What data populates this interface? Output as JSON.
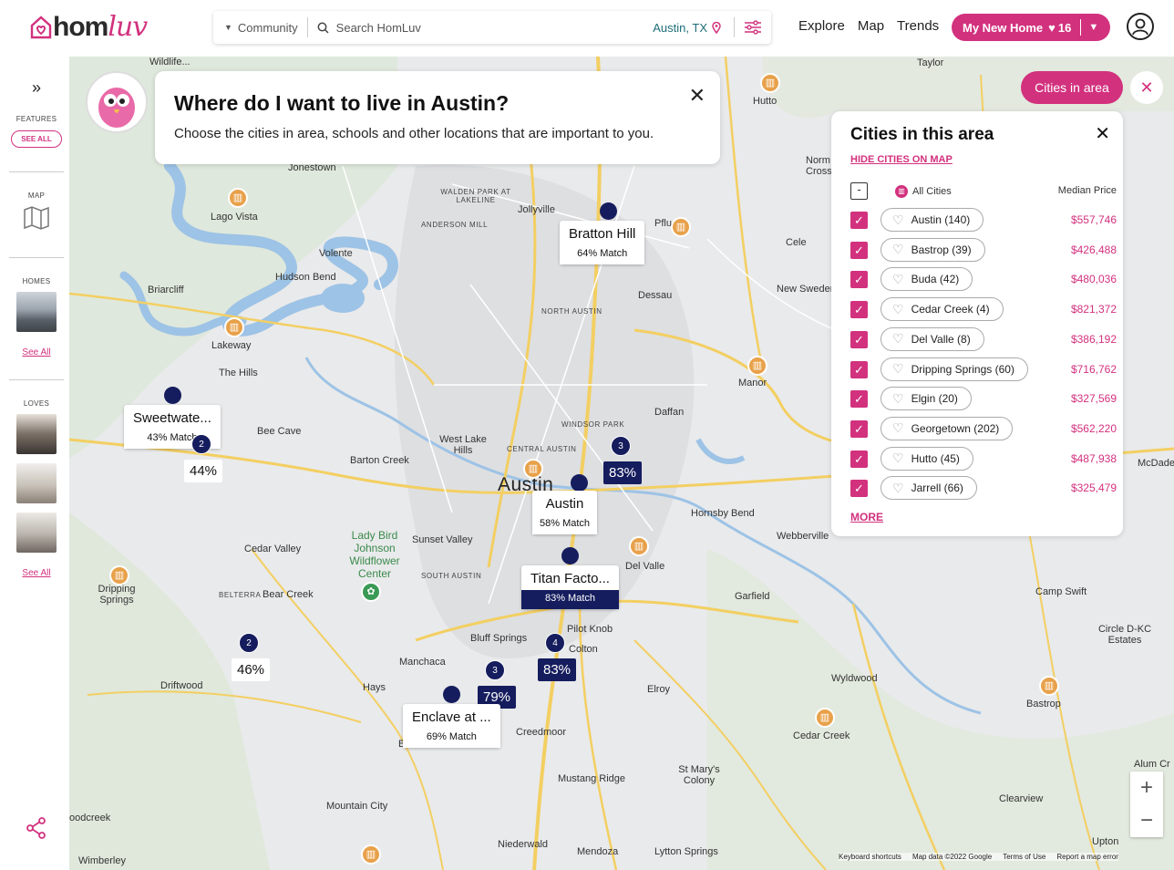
{
  "app": {
    "brand_home": "hom",
    "brand_luv": "luv"
  },
  "search": {
    "community_label": "Community",
    "placeholder": "Search HomLuv",
    "location": "Austin, TX"
  },
  "nav": {
    "explore": "Explore",
    "map": "Map",
    "trends": "Trends"
  },
  "my_home": {
    "label": "My New Home",
    "count": "16"
  },
  "sidebar": {
    "features_label": "FEATURES",
    "features_btn": "SEE ALL",
    "map_label": "MAP",
    "homes_label": "HOMES",
    "homes_link": "See All",
    "loves_label": "LOVES",
    "loves_link": "See All"
  },
  "banner": {
    "title": "Where do I want to live in Austin?",
    "subtitle": "Choose the cities in area, schools and other locations that are important to you."
  },
  "cities_button": "Cities in area",
  "panel": {
    "title": "Cities in this area",
    "hide_link": "HIDE CITIES ON MAP",
    "all_cities": "All Cities",
    "median_price": "Median Price",
    "more": "MORE",
    "cities": [
      {
        "name": "Austin (140)",
        "price": "$557,746"
      },
      {
        "name": "Bastrop (39)",
        "price": "$426,488"
      },
      {
        "name": "Buda (42)",
        "price": "$480,036"
      },
      {
        "name": "Cedar Creek (4)",
        "price": "$821,372"
      },
      {
        "name": "Del Valle (8)",
        "price": "$386,192"
      },
      {
        "name": "Dripping Springs (60)",
        "price": "$716,762"
      },
      {
        "name": "Elgin (20)",
        "price": "$327,569"
      },
      {
        "name": "Georgetown (202)",
        "price": "$562,220"
      },
      {
        "name": "Hutto (45)",
        "price": "$487,938"
      },
      {
        "name": "Jarrell (66)",
        "price": "$325,479"
      }
    ]
  },
  "pins": {
    "bratton": {
      "name": "Bratton Hill",
      "match": "64% Match"
    },
    "sweetwater": {
      "name": "Sweetwate...",
      "match": "43% Match"
    },
    "austin": {
      "name": "Austin",
      "match": "58% Match"
    },
    "titan": {
      "name": "Titan Facto...",
      "match": "83% Match"
    },
    "enclave": {
      "name": "Enclave at ...",
      "match": "69% Match"
    },
    "pct_44": "44%",
    "pct_83a": "83%",
    "pct_46": "46%",
    "pct_83b": "83%",
    "pct_79": "79%",
    "count_2a": "2",
    "count_3a": "3",
    "count_2b": "2",
    "count_4": "4",
    "count_3b": "3"
  },
  "places": {
    "wildlife": "Wildlife...",
    "jonestown": "Jonestown",
    "lago_vista": "Lago Vista",
    "jollyville": "Jollyville",
    "walden": "WALDEN PARK AT LAKELINE",
    "anderson": "ANDERSON MILL",
    "volente": "Volente",
    "hudson": "Hudson Bend",
    "briarcliff": "Briarcliff",
    "lakeway": "Lakeway",
    "the_hills": "The Hills",
    "bee_cave": "Bee Cave",
    "barton_creek": "Barton Creek",
    "west_lake": "West Lake Hills",
    "north_austin": "NORTH AUSTIN",
    "windsor": "WINDSOR PARK",
    "central": "CENTRAL AUSTIN",
    "austin_big": "Austin",
    "dessau": "Dessau",
    "daffan": "Daffan",
    "manor": "Manor",
    "hutto": "Hutto",
    "taylor": "Taylor",
    "cele": "Cele",
    "new_sweden": "New Sweden",
    "norm_cross": "Norm Cross",
    "sunset": "Sunset Valley",
    "lady_bird": "Lady Bird Johnson Wildflower Center",
    "south_austin": "SOUTH AUSTIN",
    "cedar_valley": "Cedar Valley",
    "dripping": "Dripping Springs",
    "belterra": "BELTERRA",
    "bear_creek": "Bear Creek",
    "del_valle": "Del Valle",
    "hornsby": "Hornsby Bend",
    "webberville": "Webberville",
    "garfield": "Garfield",
    "bluff": "Bluff Springs",
    "pilot": "Pilot Knob",
    "colton": "Colton",
    "manchaca": "Manchaca",
    "hays": "Hays",
    "driftwood": "Driftwood",
    "elroy": "Elroy",
    "creedmoor": "Creedmoor",
    "buda": "Bud",
    "mustang": "Mustang Ridge",
    "st_marys": "St Mary's Colony",
    "mountain_city": "Mountain City",
    "niederwald": "Niederwald",
    "mendoza": "Mendoza",
    "lytton": "Lytton Springs",
    "woodcreek": "oodcreek",
    "wimberley": "Wimberley",
    "camp_swift": "Camp Swift",
    "circle_d": "Circle D-KC Estates",
    "wyldwood": "Wyldwood",
    "bastrop": "Bastrop",
    "cedar_creek": "Cedar Creek",
    "clearview": "Clearview",
    "upton": "Upton",
    "alum": "Alum Cr",
    "mcdade": "McDade",
    "pflug": "Pflug e"
  },
  "map_footer": {
    "shortcuts": "Keyboard shortcuts",
    "data": "Map data ©2022 Google",
    "terms": "Terms of Use",
    "report": "Report a map error"
  },
  "colors": {
    "accent": "#d2317e",
    "navy": "#151d5e",
    "amenity": "#e8a14a"
  }
}
